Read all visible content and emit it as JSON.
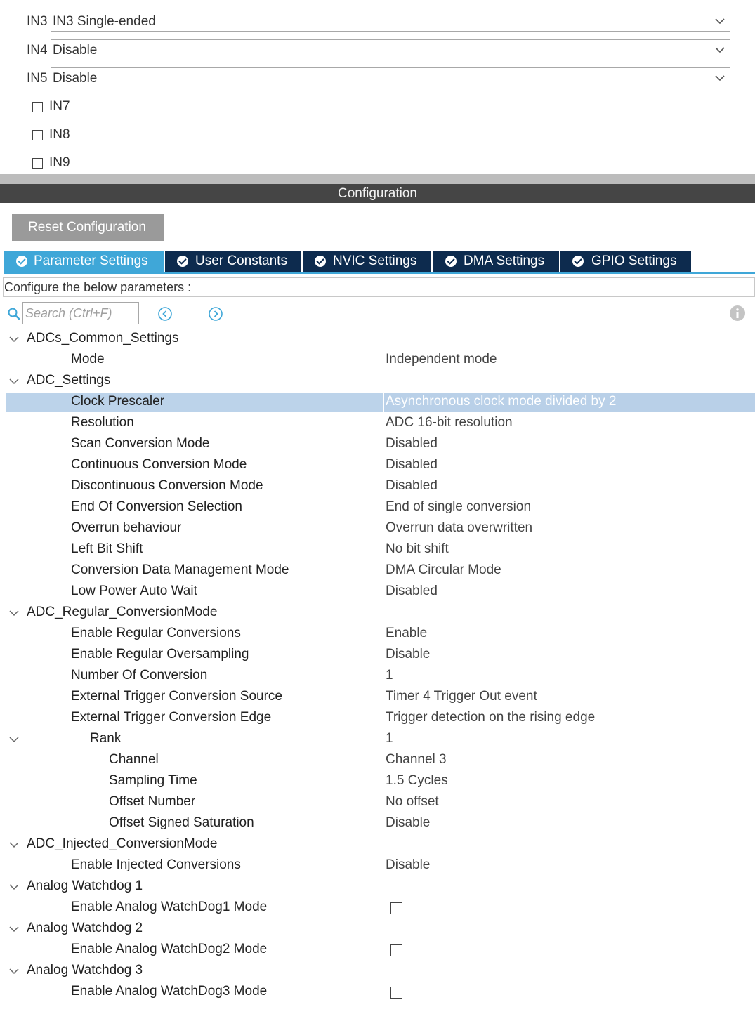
{
  "channels": [
    {
      "label": "IN3",
      "value": "IN3 Single-ended"
    },
    {
      "label": "IN4",
      "value": "Disable"
    },
    {
      "label": "IN5",
      "value": "Disable"
    }
  ],
  "channel_checkboxes": [
    {
      "label": "IN7",
      "checked": false
    },
    {
      "label": "IN8",
      "checked": false
    },
    {
      "label": "IN9",
      "checked": false
    }
  ],
  "configuration_title": "Configuration",
  "reset_button": "Reset Configuration",
  "tabs": [
    {
      "label": "Parameter Settings",
      "active": true
    },
    {
      "label": "User Constants",
      "active": false
    },
    {
      "label": "NVIC Settings",
      "active": false
    },
    {
      "label": "DMA Settings",
      "active": false
    },
    {
      "label": "GPIO Settings",
      "active": false
    }
  ],
  "hint": "Configure the below parameters :",
  "search": {
    "placeholder": "Search (Ctrl+F)"
  },
  "icons": {
    "search": "search-icon",
    "prev": "circle-chevron-left-icon",
    "next": "circle-chevron-right-icon",
    "info": "info-icon",
    "collapse": "chevron-down-icon"
  },
  "colors": {
    "tab_active": "#3fa7d8",
    "tab_inactive": "#0d2b4e",
    "config_bar": "#454545",
    "selected_row": "#bcd3ea"
  },
  "tree": [
    {
      "type": "group",
      "name": "ADCs_Common_Settings"
    },
    {
      "type": "param",
      "name": "Mode",
      "value": "Independent mode"
    },
    {
      "type": "group",
      "name": "ADC_Settings"
    },
    {
      "type": "param",
      "name": "Clock Prescaler",
      "value": "Asynchronous clock mode divided by 2",
      "selected": true
    },
    {
      "type": "param",
      "name": "Resolution",
      "value": "ADC 16-bit resolution"
    },
    {
      "type": "param",
      "name": "Scan Conversion Mode",
      "value": "Disabled"
    },
    {
      "type": "param",
      "name": "Continuous Conversion Mode",
      "value": "Disabled"
    },
    {
      "type": "param",
      "name": "Discontinuous Conversion Mode",
      "value": "Disabled"
    },
    {
      "type": "param",
      "name": "End Of Conversion Selection",
      "value": "End of single conversion"
    },
    {
      "type": "param",
      "name": "Overrun behaviour",
      "value": "Overrun data overwritten"
    },
    {
      "type": "param",
      "name": "Left Bit Shift",
      "value": "No bit shift"
    },
    {
      "type": "param",
      "name": "Conversion Data Management Mode",
      "value": "DMA Circular Mode"
    },
    {
      "type": "param",
      "name": "Low Power Auto Wait",
      "value": "Disabled"
    },
    {
      "type": "group",
      "name": "ADC_Regular_ConversionMode"
    },
    {
      "type": "param",
      "name": "Enable Regular Conversions",
      "value": "Enable"
    },
    {
      "type": "param",
      "name": "Enable Regular Oversampling",
      "value": "Disable"
    },
    {
      "type": "param",
      "name": "Number Of Conversion",
      "value": "1"
    },
    {
      "type": "param",
      "name": "External Trigger Conversion Source",
      "value": "Timer 4 Trigger Out event"
    },
    {
      "type": "param",
      "name": "External Trigger Conversion Edge",
      "value": "Trigger detection on the rising edge"
    },
    {
      "type": "subgroup",
      "name": "Rank",
      "value": "1"
    },
    {
      "type": "subparam",
      "name": "Channel",
      "value": "Channel 3"
    },
    {
      "type": "subparam",
      "name": "Sampling Time",
      "value": "1.5 Cycles"
    },
    {
      "type": "subparam",
      "name": "Offset Number",
      "value": "No offset"
    },
    {
      "type": "subparam",
      "name": "Offset Signed Saturation",
      "value": "Disable"
    },
    {
      "type": "group",
      "name": "ADC_Injected_ConversionMode"
    },
    {
      "type": "param",
      "name": "Enable Injected Conversions",
      "value": "Disable"
    },
    {
      "type": "group",
      "name": "Analog Watchdog 1"
    },
    {
      "type": "check",
      "name": "Enable Analog WatchDog1 Mode",
      "checked": false
    },
    {
      "type": "group",
      "name": "Analog Watchdog 2"
    },
    {
      "type": "check",
      "name": "Enable Analog WatchDog2 Mode",
      "checked": false
    },
    {
      "type": "group",
      "name": "Analog Watchdog 3"
    },
    {
      "type": "check",
      "name": "Enable Analog WatchDog3 Mode",
      "checked": false
    }
  ]
}
